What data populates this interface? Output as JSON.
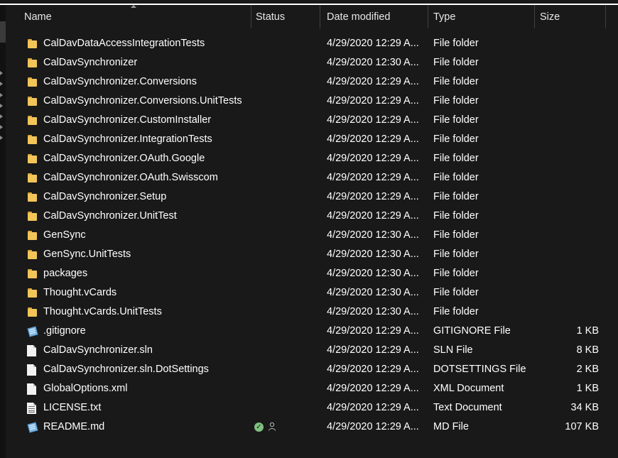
{
  "columns": {
    "name": "Name",
    "status": "Status",
    "date": "Date modified",
    "type": "Type",
    "size": "Size"
  },
  "files": [
    {
      "name": "CalDavDataAccessIntegrationTests",
      "icon": "folder-icon",
      "status": "",
      "date": "4/29/2020 12:29 A...",
      "type": "File folder",
      "size": ""
    },
    {
      "name": "CalDavSynchronizer",
      "icon": "folder-icon",
      "status": "",
      "date": "4/29/2020 12:30 A...",
      "type": "File folder",
      "size": ""
    },
    {
      "name": "CalDavSynchronizer.Conversions",
      "icon": "folder-icon",
      "status": "",
      "date": "4/29/2020 12:29 A...",
      "type": "File folder",
      "size": ""
    },
    {
      "name": "CalDavSynchronizer.Conversions.UnitTests",
      "icon": "folder-icon",
      "status": "",
      "date": "4/29/2020 12:29 A...",
      "type": "File folder",
      "size": ""
    },
    {
      "name": "CalDavSynchronizer.CustomInstaller",
      "icon": "folder-icon",
      "status": "",
      "date": "4/29/2020 12:29 A...",
      "type": "File folder",
      "size": ""
    },
    {
      "name": "CalDavSynchronizer.IntegrationTests",
      "icon": "folder-icon",
      "status": "",
      "date": "4/29/2020 12:29 A...",
      "type": "File folder",
      "size": ""
    },
    {
      "name": "CalDavSynchronizer.OAuth.Google",
      "icon": "folder-icon",
      "status": "",
      "date": "4/29/2020 12:29 A...",
      "type": "File folder",
      "size": ""
    },
    {
      "name": "CalDavSynchronizer.OAuth.Swisscom",
      "icon": "folder-icon",
      "status": "",
      "date": "4/29/2020 12:29 A...",
      "type": "File folder",
      "size": ""
    },
    {
      "name": "CalDavSynchronizer.Setup",
      "icon": "folder-icon",
      "status": "",
      "date": "4/29/2020 12:29 A...",
      "type": "File folder",
      "size": ""
    },
    {
      "name": "CalDavSynchronizer.UnitTest",
      "icon": "folder-icon",
      "status": "",
      "date": "4/29/2020 12:29 A...",
      "type": "File folder",
      "size": ""
    },
    {
      "name": "GenSync",
      "icon": "folder-icon",
      "status": "",
      "date": "4/29/2020 12:30 A...",
      "type": "File folder",
      "size": ""
    },
    {
      "name": "GenSync.UnitTests",
      "icon": "folder-icon",
      "status": "",
      "date": "4/29/2020 12:30 A...",
      "type": "File folder",
      "size": ""
    },
    {
      "name": "packages",
      "icon": "folder-icon",
      "status": "",
      "date": "4/29/2020 12:30 A...",
      "type": "File folder",
      "size": ""
    },
    {
      "name": "Thought.vCards",
      "icon": "folder-icon",
      "status": "",
      "date": "4/29/2020 12:30 A...",
      "type": "File folder",
      "size": ""
    },
    {
      "name": "Thought.vCards.UnitTests",
      "icon": "folder-icon",
      "status": "",
      "date": "4/29/2020 12:30 A...",
      "type": "File folder",
      "size": ""
    },
    {
      "name": ".gitignore",
      "icon": "notepad-file-icon",
      "status": "",
      "date": "4/29/2020 12:29 A...",
      "type": "GITIGNORE File",
      "size": "1 KB"
    },
    {
      "name": "CalDavSynchronizer.sln",
      "icon": "blank-file-icon",
      "status": "",
      "date": "4/29/2020 12:29 A...",
      "type": "SLN File",
      "size": "8 KB"
    },
    {
      "name": "CalDavSynchronizer.sln.DotSettings",
      "icon": "blank-file-icon",
      "status": "",
      "date": "4/29/2020 12:29 A...",
      "type": "DOTSETTINGS File",
      "size": "2 KB"
    },
    {
      "name": "GlobalOptions.xml",
      "icon": "blank-file-icon",
      "status": "",
      "date": "4/29/2020 12:29 A...",
      "type": "XML Document",
      "size": "1 KB"
    },
    {
      "name": "LICENSE.txt",
      "icon": "text-file-icon",
      "status": "",
      "date": "4/29/2020 12:29 A...",
      "type": "Text Document",
      "size": "34 KB"
    },
    {
      "name": "README.md",
      "icon": "notepad-file-icon",
      "status": "synced-shared",
      "date": "4/29/2020 12:29 A...",
      "type": "MD File",
      "size": "107 KB"
    }
  ],
  "colors": {
    "background": "#191919",
    "text": "#ffffff",
    "folder": "#f2c558",
    "status_ok": "#7fbf7f"
  }
}
